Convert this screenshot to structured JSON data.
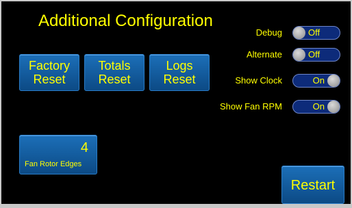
{
  "title": "Additional Configuration",
  "buttons": {
    "factory_reset": [
      "Factory",
      "Reset"
    ],
    "totals_reset": [
      "Totals",
      "Reset"
    ],
    "logs_reset": [
      "Logs",
      "Reset"
    ],
    "fan_rotor_edges": {
      "value": "4",
      "label": "Fan Rotor Edges"
    },
    "restart": "Restart"
  },
  "toggles": {
    "debug": {
      "label": "Debug",
      "state": "Off"
    },
    "alternate": {
      "label": "Alternate",
      "state": "Off"
    },
    "show_clock": {
      "label": "Show Clock",
      "state": "On"
    },
    "show_fan_rpm": {
      "label": "Show Fan RPM",
      "state": "On"
    }
  },
  "colors": {
    "background": "#000000",
    "text": "#ffff00",
    "button": "#1c6fb8",
    "toggle_track": "#0d2b7a",
    "toggle_knob": "#b0b0b0"
  }
}
